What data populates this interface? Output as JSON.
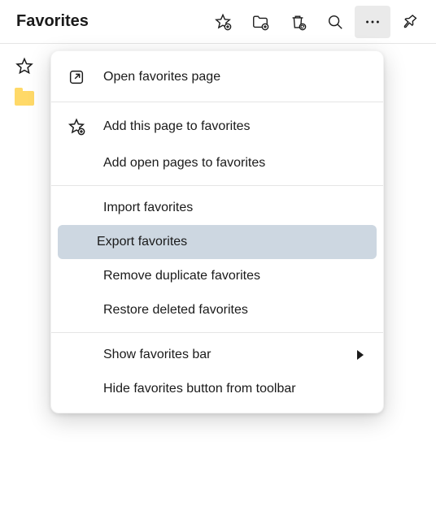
{
  "header": {
    "title": "Favorites",
    "icons": {
      "add_favorite": "star-plus-icon",
      "add_folder": "folder-plus-icon",
      "restore": "trash-restore-icon",
      "search": "search-icon",
      "more": "more-icon",
      "pin": "pin-icon"
    }
  },
  "sidebar": {
    "star": "star-outline-icon",
    "folder": "folder-icon"
  },
  "menu": {
    "open_page": "Open favorites page",
    "add_this_page": "Add this page to favorites",
    "add_open_pages": "Add open pages to favorites",
    "import": "Import favorites",
    "export": "Export favorites",
    "remove_duplicates": "Remove duplicate favorites",
    "restore_deleted": "Restore deleted favorites",
    "show_bar": "Show favorites bar",
    "hide_button": "Hide favorites button from toolbar"
  },
  "state": {
    "highlighted": "export",
    "more_active": true
  }
}
